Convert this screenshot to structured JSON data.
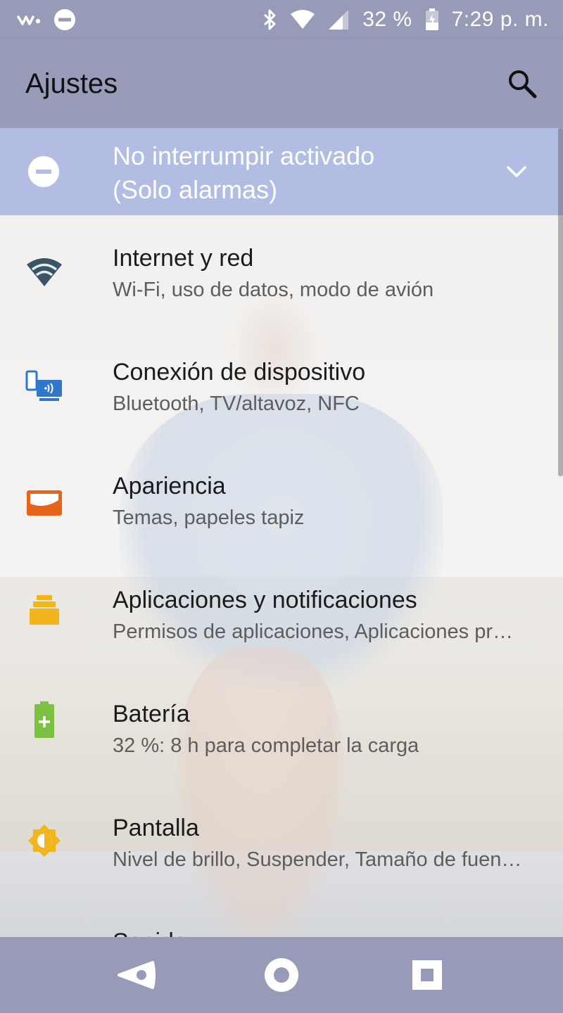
{
  "status_bar": {
    "battery_percent": "32 %",
    "time": "7:29 p. m.",
    "icons": [
      "walkman-icon",
      "dnd-status-icon",
      "bluetooth-icon",
      "wifi-status-icon",
      "signal-icon",
      "battery-charging-icon"
    ]
  },
  "app_bar": {
    "title": "Ajustes",
    "search_icon": "search-icon"
  },
  "dnd_banner": {
    "line1": "No interrumpir activado",
    "line2": "(Solo alarmas)",
    "icon": "dnd-icon",
    "expand_icon": "chevron-down-icon"
  },
  "settings": [
    {
      "title": "Internet y red",
      "subtitle": "Wi-Fi, uso de datos, modo de avión",
      "icon": "wifi-icon",
      "color": "#3b5566"
    },
    {
      "title": "Conexión de dispositivo",
      "subtitle": "Bluetooth, TV/altavoz, NFC",
      "icon": "device-connection-icon",
      "color": "#2f78c9"
    },
    {
      "title": "Apariencia",
      "subtitle": "Temas, papeles tapiz",
      "icon": "appearance-icon",
      "color": "#e8641b"
    },
    {
      "title": "Aplicaciones y notificaciones",
      "subtitle": "Permisos de aplicaciones, Aplicaciones pr…",
      "icon": "apps-icon",
      "color": "#f2b51b"
    },
    {
      "title": "Batería",
      "subtitle": "32 %: 8 h para completar la carga",
      "icon": "battery-icon",
      "color": "#7cc242"
    },
    {
      "title": "Pantalla",
      "subtitle": "Nivel de brillo, Suspender, Tamaño de fuen…",
      "icon": "brightness-icon",
      "color": "#f2b51b"
    },
    {
      "title": "Sonido",
      "subtitle": "",
      "icon": "sound-icon",
      "color": "#3b5566"
    }
  ],
  "nav_bar": {
    "back": "back-icon",
    "home": "home-icon",
    "recents": "recents-icon"
  },
  "colors": {
    "status_bar": "#989bb8",
    "app_bar": "#989cb8",
    "dnd_banner": "#b3bce3"
  }
}
